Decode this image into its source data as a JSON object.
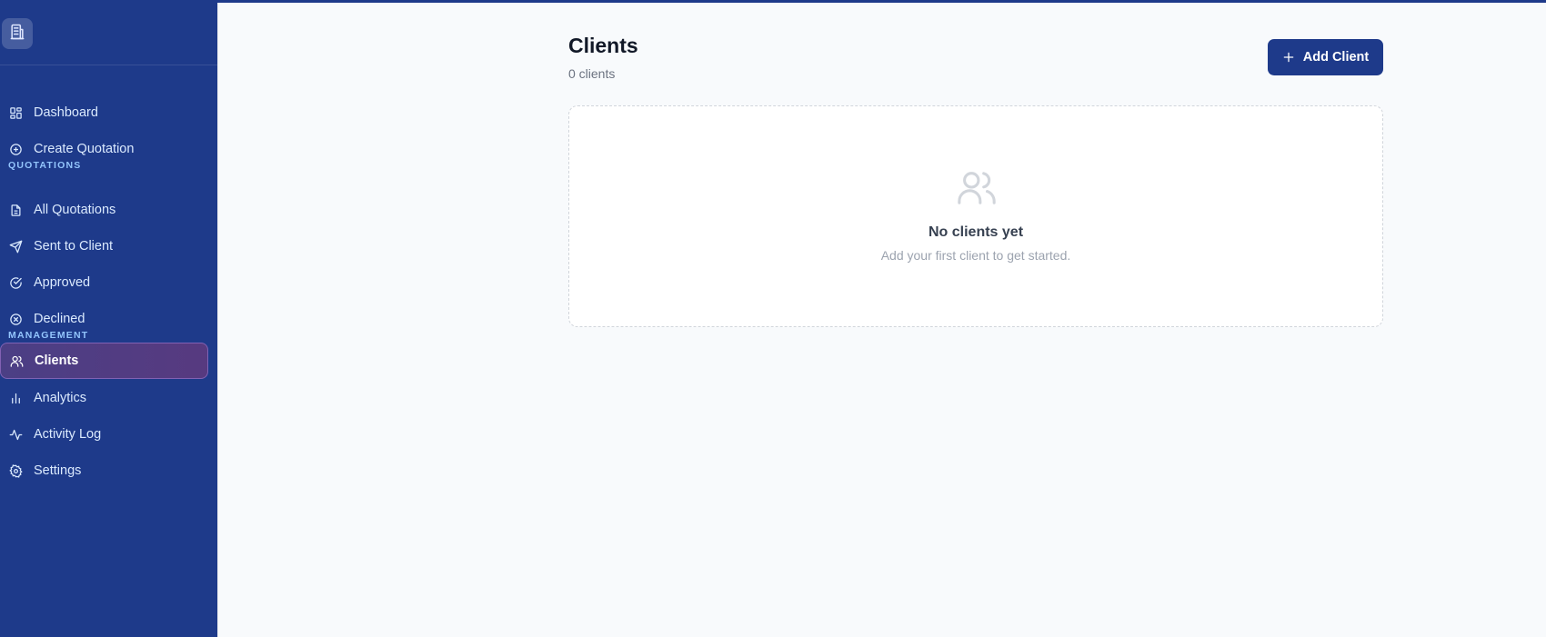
{
  "colors": {
    "sidebar_bg": "#1e3a8a",
    "active_item": "#4b3f85",
    "primary_button": "#1e3a8a",
    "page_bg": "#f8fafc"
  },
  "logo": {
    "icon": "building-icon"
  },
  "sidebar": {
    "items_top": [
      {
        "label": "Dashboard",
        "icon": "dashboard-icon"
      },
      {
        "label": "Create Quotation",
        "icon": "plus-circle-icon"
      }
    ],
    "section_quotations": "QUOTATIONS",
    "items_quotations": [
      {
        "label": "All Quotations",
        "icon": "document-icon"
      },
      {
        "label": "Sent to Client",
        "icon": "send-icon"
      },
      {
        "label": "Approved",
        "icon": "check-circle-icon"
      },
      {
        "label": "Declined",
        "icon": "x-circle-icon"
      }
    ],
    "section_management": "MANAGEMENT",
    "items_management": [
      {
        "label": "Clients",
        "icon": "users-icon",
        "active": true
      },
      {
        "label": "Analytics",
        "icon": "bar-chart-icon"
      },
      {
        "label": "Activity Log",
        "icon": "activity-icon"
      },
      {
        "label": "Settings",
        "icon": "gear-icon"
      }
    ]
  },
  "main": {
    "title": "Clients",
    "count": "0 clients",
    "add_button": "Add Client",
    "empty": {
      "icon": "users-icon",
      "title": "No clients yet",
      "subtitle": "Add your first client to get started."
    }
  }
}
